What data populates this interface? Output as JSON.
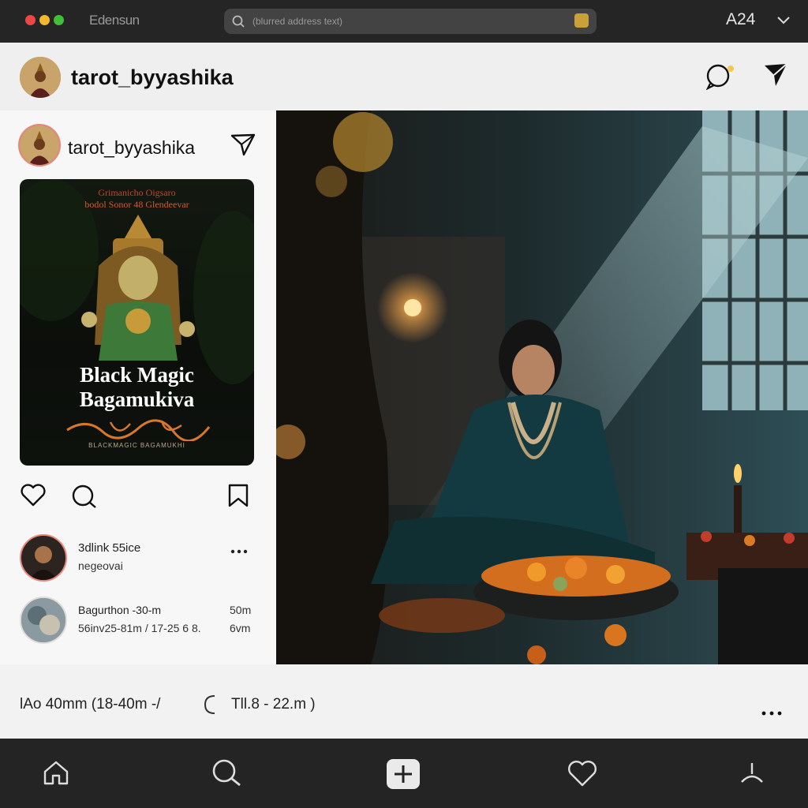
{
  "browser": {
    "brand": "Edensun",
    "address_placeholder": "(blurred address text)",
    "user_label": "A24"
  },
  "header": {
    "username": "tarot_byyashika"
  },
  "post_card": {
    "username": "tarot_byyashika",
    "poster": {
      "top_line_1": "Grimanicho Oigsaro",
      "top_line_2": "bodol Sonor 48 Glendeevar",
      "title_line_1": "Black Magic",
      "title_line_2": "Bagamukiva",
      "footer_text": "BLACKMAGIC BAGAMUKHI"
    }
  },
  "comments": [
    {
      "line1": "3dlink 55ice",
      "line2": "negeovai",
      "time": "",
      "has_more": true
    },
    {
      "line1": "Bagurthon -30-m",
      "line2": "56inv25-81m / 17-25 6 8.",
      "time1": "50m",
      "time2": "6vm"
    }
  ],
  "footer": {
    "left_text": "lAo 40mm (18-40m -/",
    "right_text": "Tll.8 - 22.m )"
  },
  "nav": {
    "items": [
      "home-icon",
      "search-icon",
      "add-post-icon",
      "heart-icon",
      "profile-icon"
    ]
  },
  "colors": {
    "accent_story_ring": "#e7877f",
    "nav_bg": "#242424"
  }
}
